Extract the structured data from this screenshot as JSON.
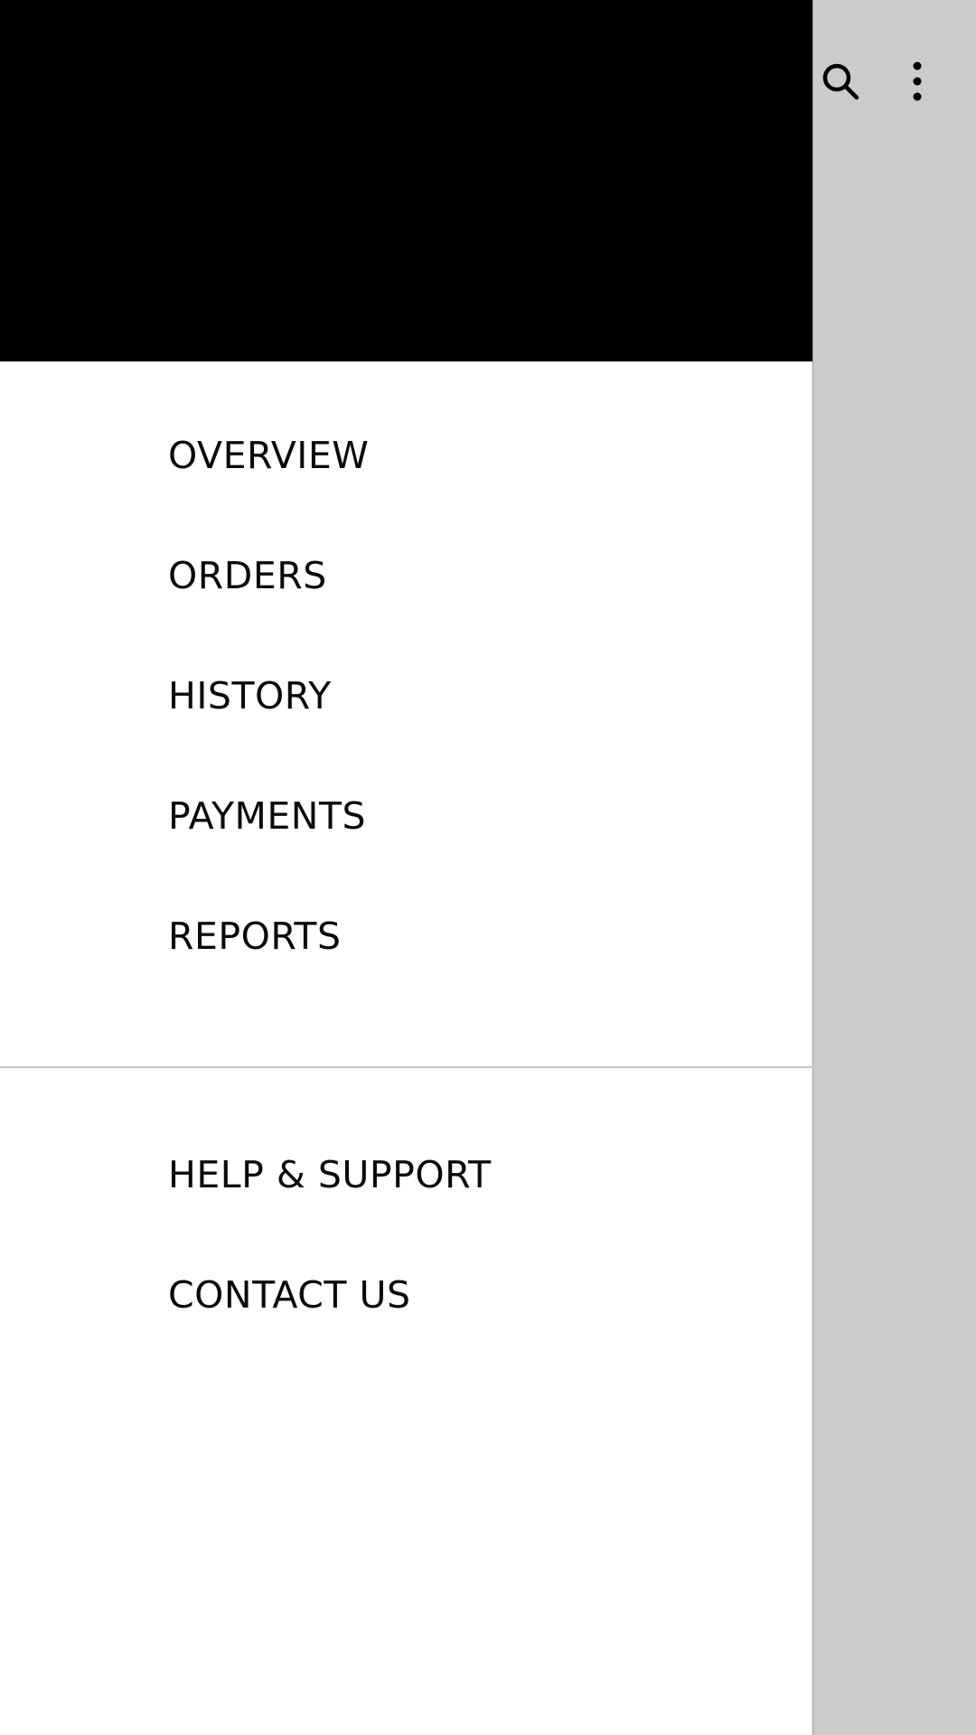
{
  "app_bar": {
    "actions": [
      {
        "icon": "search-icon",
        "label": ""
      },
      {
        "icon": "more-vert-icon",
        "label": ""
      }
    ]
  },
  "drawer": {
    "primary_items": [
      {
        "label": "OVERVIEW"
      },
      {
        "label": "ORDERS"
      },
      {
        "label": "HISTORY"
      },
      {
        "label": "PAYMENTS"
      },
      {
        "label": "REPORTS"
      }
    ],
    "secondary_items": [
      {
        "label": "HELP & SUPPORT"
      },
      {
        "label": "CONTACT US"
      }
    ]
  },
  "colors": {
    "drawer_header": "#000000",
    "drawer_background": "#ffffff",
    "scrim": "#cbcbcb",
    "text": "#0a0a0a",
    "divider": "#c4c4c4"
  }
}
